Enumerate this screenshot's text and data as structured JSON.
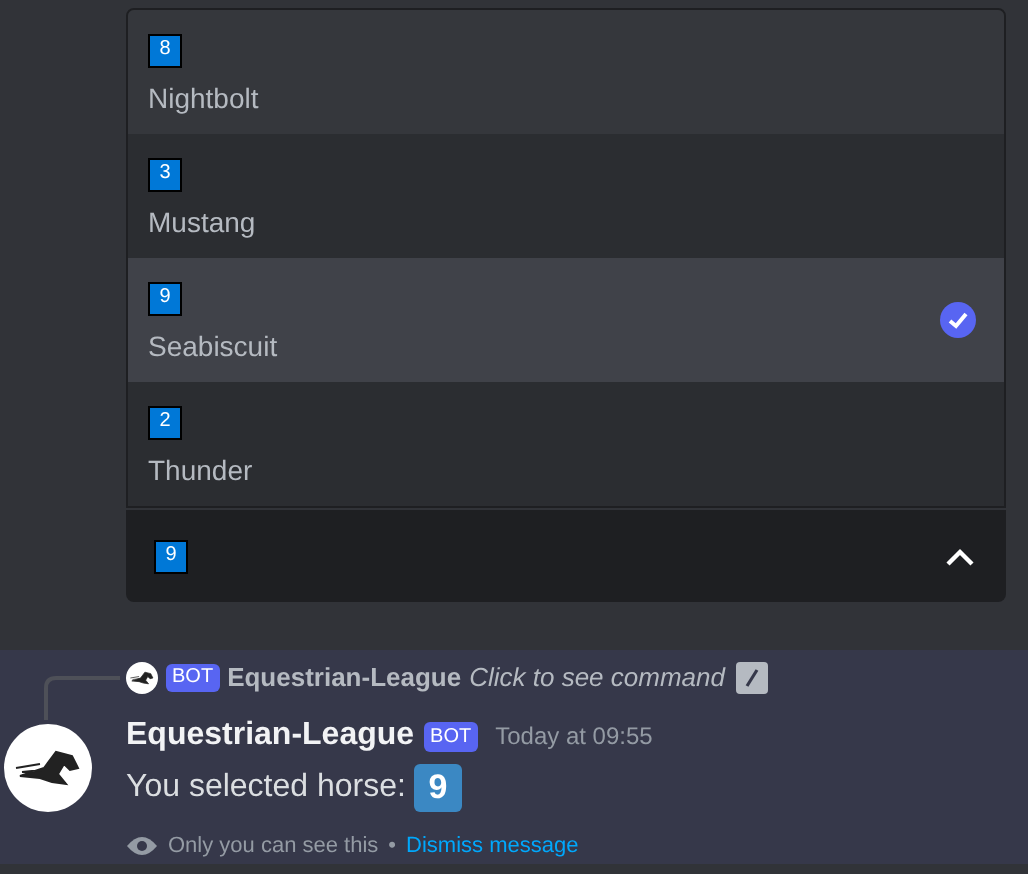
{
  "select_menu": {
    "options": [
      {
        "emoji": "8",
        "label": "Nightbolt",
        "selected": false,
        "hovered": true
      },
      {
        "emoji": "3",
        "label": "Mustang",
        "selected": false,
        "hovered": false
      },
      {
        "emoji": "9",
        "label": "Seabiscuit",
        "selected": true,
        "hovered": false
      },
      {
        "emoji": "2",
        "label": "Thunder",
        "selected": false,
        "hovered": false
      }
    ],
    "value": "9",
    "expanded": true
  },
  "message": {
    "reply": {
      "badge": "BOT",
      "author": "Equestrian-League",
      "command": "Click to see command"
    },
    "author": "Equestrian-League",
    "badge": "BOT",
    "timestamp": "Today at 09:55",
    "text": "You selected horse:",
    "emoji": "9",
    "notice": "Only you can see this",
    "separator": "•",
    "dismiss": "Dismiss message"
  }
}
